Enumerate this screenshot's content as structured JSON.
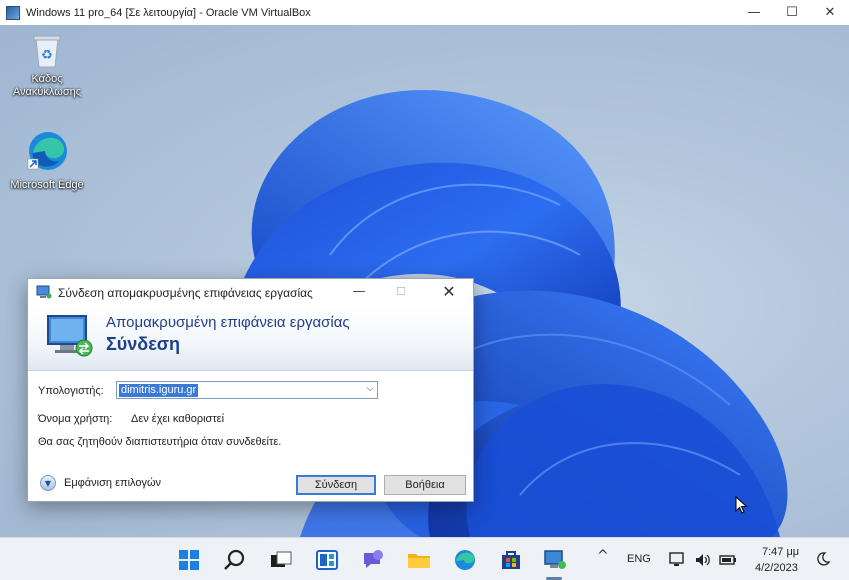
{
  "host": {
    "title": "Windows 11 pro_64 [Σε λειτουργία] - Oracle VM VirtualBox",
    "controls": {
      "minimize": "—",
      "maximize": "☐",
      "close": "✕"
    }
  },
  "desktop": {
    "icons": [
      {
        "label_line1": "Κάδος",
        "label_line2": "Ανακύκλωσης",
        "icon": "recycle-bin-icon"
      },
      {
        "label_line1": "Microsoft Edge",
        "label_line2": "",
        "icon": "edge-icon"
      }
    ]
  },
  "dialog": {
    "title": "Σύνδεση απομακρυσμένης επιφάνειας εργασίας",
    "controls": {
      "minimize": "—",
      "maximize": "☐",
      "close": "✕"
    },
    "banner": {
      "line1": "Απομακρυσμένη επιφάνεια εργασίας",
      "line2": "Σύνδεση"
    },
    "computer_label": "Υπολογιστής:",
    "computer_value": "dimitris.iguru.gr",
    "username_label": "Όνομα χρήστη:",
    "username_value": "Δεν έχει καθοριστεί",
    "credentials_note": "Θα σας ζητηθούν διαπιστευτήρια όταν συνδεθείτε.",
    "show_options": "Εμφάνιση επιλογών",
    "connect_button": "Σύνδεση",
    "help_button": "Βοήθεια"
  },
  "taskbar": {
    "language": "ENG",
    "time": "7:47 μμ",
    "date": "4/2/2023",
    "tray_chevron": "^"
  }
}
